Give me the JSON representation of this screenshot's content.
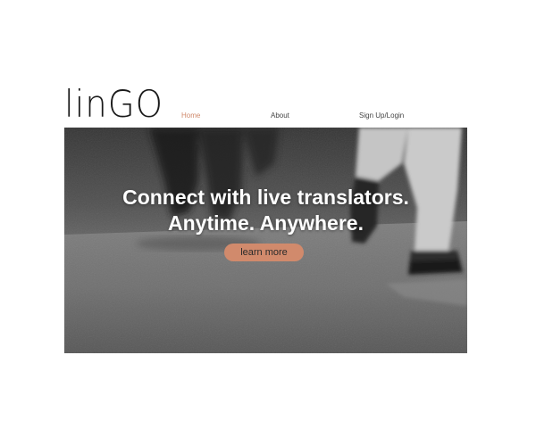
{
  "brand": {
    "logo_text": "linGO"
  },
  "nav": {
    "items": [
      {
        "label": "Home",
        "active": true
      },
      {
        "label": "About",
        "active": false
      },
      {
        "label": "Sign Up/Login",
        "active": false
      }
    ]
  },
  "hero": {
    "headline_line1": "Connect with live translators.",
    "headline_line2": "Anytime. Anywhere.",
    "cta_label": "learn more"
  },
  "colors": {
    "accent": "#d18a6c",
    "nav_text": "#444444",
    "logo_text": "#1a1a1a"
  }
}
